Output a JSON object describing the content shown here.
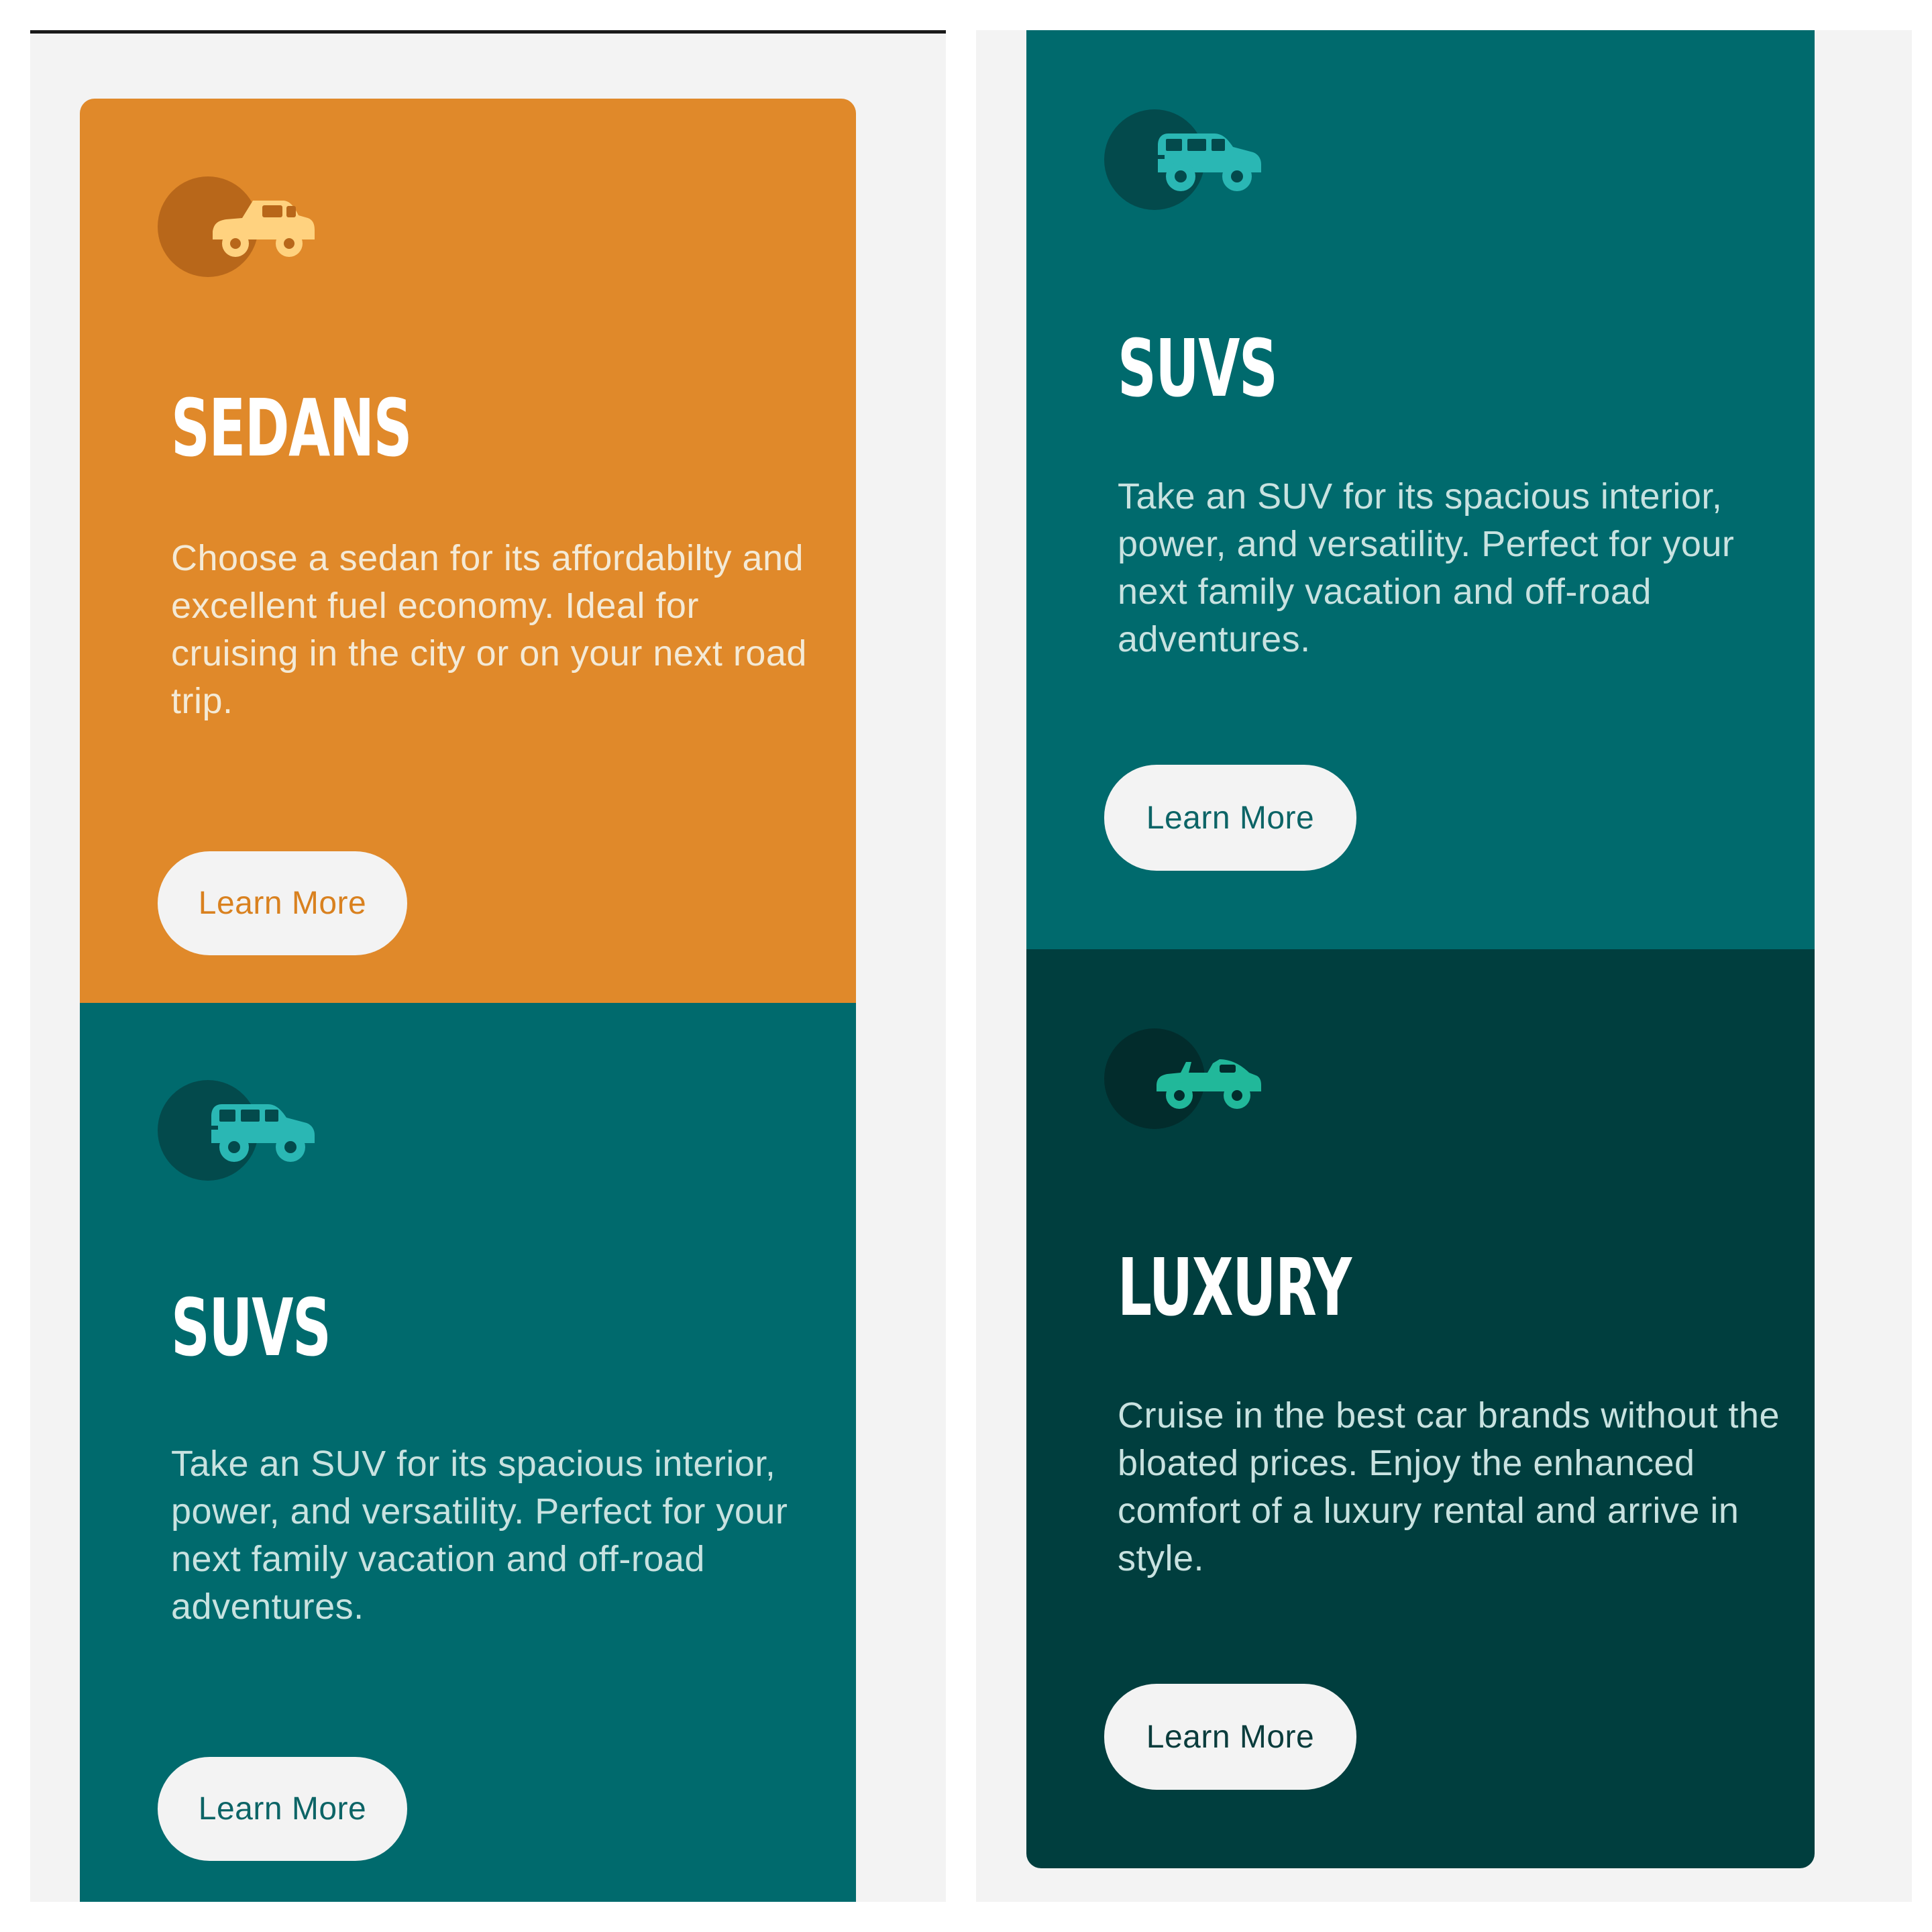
{
  "colors": {
    "background": "#f3f3f3",
    "orange": "#e0892a",
    "teal": "#006a6d",
    "dark_green": "#003e3e",
    "white": "#ffffff",
    "orange_text": "#f4ead6",
    "teal_text": "#c8e2e0",
    "orange_button_text": "#d9811f",
    "teal_button_text": "#0c6466",
    "dark_button_text": "#0a3c3c"
  },
  "left_panel": {
    "cards": [
      {
        "icon": "sedan-icon",
        "title": "SEDANS",
        "description": "Choose a sedan for its affordabilty and excellent fuel economy. Ideal for cruising in the city or on your next road trip.",
        "button_label": "Learn More"
      },
      {
        "icon": "suv-icon",
        "title": "SUVS",
        "description": "Take an SUV for its spacious interior, power, and versatility. Perfect for your next family vacation and off-road adventures.",
        "button_label": "Learn More"
      }
    ]
  },
  "right_panel": {
    "cards": [
      {
        "icon": "suv-icon",
        "title": "SUVS",
        "description": "Take an SUV for its spacious interior, power, and versatility. Perfect for your next family vacation and off-road adventures.",
        "button_label": "Learn More"
      },
      {
        "icon": "convertible-icon",
        "title": "LUXURY",
        "description": "Cruise in the best car brands without the bloated prices. Enjoy the enhanced comfort of a luxury rental and arrive in style.",
        "button_label": "Learn More"
      }
    ]
  }
}
